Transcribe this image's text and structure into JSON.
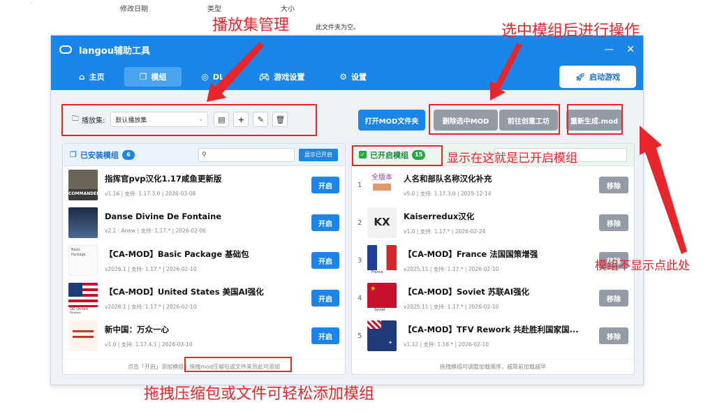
{
  "background": {
    "cols": [
      "修改日期",
      "类型",
      "大小"
    ],
    "empty": "此文件夹为空。"
  },
  "window": {
    "title": "langou辅助工具",
    "controls": {
      "minimize": "—",
      "close": "✕"
    }
  },
  "nav": {
    "items": [
      {
        "label": "主页",
        "icon": "home-icon"
      },
      {
        "label": "模组",
        "icon": "cube-icon"
      },
      {
        "label": "DL",
        "icon": "download-icon"
      },
      {
        "label": "游戏设置",
        "icon": "gamepad-icon"
      },
      {
        "label": "设置",
        "icon": "gear-icon"
      }
    ],
    "launch": "启动游戏"
  },
  "playset": {
    "label": "播放集:",
    "selected": "默认播放集",
    "open_folder": "打开MOD文件夹",
    "delete_selected": "删除选中MOD",
    "workshop": "前往创意工坊",
    "regen": "重新生成.mod"
  },
  "installed": {
    "title": "已安装模组",
    "count": "6",
    "show_enabled": "显示已开启",
    "enable_label": "开启",
    "footer_prefix": "点击「开启」添加模组 |",
    "footer_drag": "拖拽mod压缩包或文件夹到此可添加",
    "mods": [
      {
        "title": "指挥官pvp汉化1.17咸鱼更新版",
        "meta": "v1.16 | 支持: 1.17.3.0 | 2026-03-08",
        "thumb_text": "COMMANDERS"
      },
      {
        "title": "Danse Divine De Fontaine",
        "meta": "v2.1 · Anew | 支持: 1.17.* | 2026-02-06",
        "thumb_text": ""
      },
      {
        "title": "【CA-MOD】Basic Package 基础包",
        "meta": "v2026.1 | 支持: 1.17.* | 2026-02-10",
        "thumb_text": "Basic Package"
      },
      {
        "title": "【CA-MOD】United States 美国AI强化",
        "meta": "v2026.1 | 支持: 1.17.* | 2026-02-10",
        "thumb_text": "OD United States"
      },
      {
        "title": "新中国：万众一心",
        "meta": "v1.0 | 支持: 1.17.4.1 | 2026-03-10",
        "thumb_text": ""
      }
    ]
  },
  "enabled": {
    "title": "已开启模组",
    "count": "15",
    "remove_label": "移除",
    "footer": "拖拽模组可调整加载顺序，越靠前加载越早",
    "mods": [
      {
        "num": "1",
        "title": "人名和部队名称汉化补充",
        "meta": "v5.0 | 支持: 1.17.3.0 | 2025-12-14",
        "thumb_text": "全版本"
      },
      {
        "num": "2",
        "title": "Kaiserredux汉化",
        "meta": "v1.0 | 支持: 1.17.* | 2026-02-24",
        "thumb_text": "KX"
      },
      {
        "num": "3",
        "title": "【CA-MOD】France 法国国策增强",
        "meta": "v2025.11 | 支持: 1.17.* | 2026-02-10",
        "thumb_text": "France"
      },
      {
        "num": "4",
        "title": "【CA-MOD】Soviet 苏联AI强化",
        "meta": "v2025.11 | 支持: 1.17.* | 2026-02-10",
        "thumb_text": "Soviet"
      },
      {
        "num": "5",
        "title": "【CA-MOD】TFV Rework 共赴胜利国家国...",
        "meta": "v1.12 | 支持: 1.16.* | 2026-02-10",
        "thumb_text": ""
      }
    ]
  },
  "annotations": {
    "playset_mgmt": "播放集管理",
    "select_ops": "选中模组后进行操作",
    "shown_here": "显示在这就是已开启模组",
    "no_show": "模组不显示点此处",
    "drag_add": "拖拽压缩包或文件可轻松添加模组",
    "color": "#e8252b"
  }
}
